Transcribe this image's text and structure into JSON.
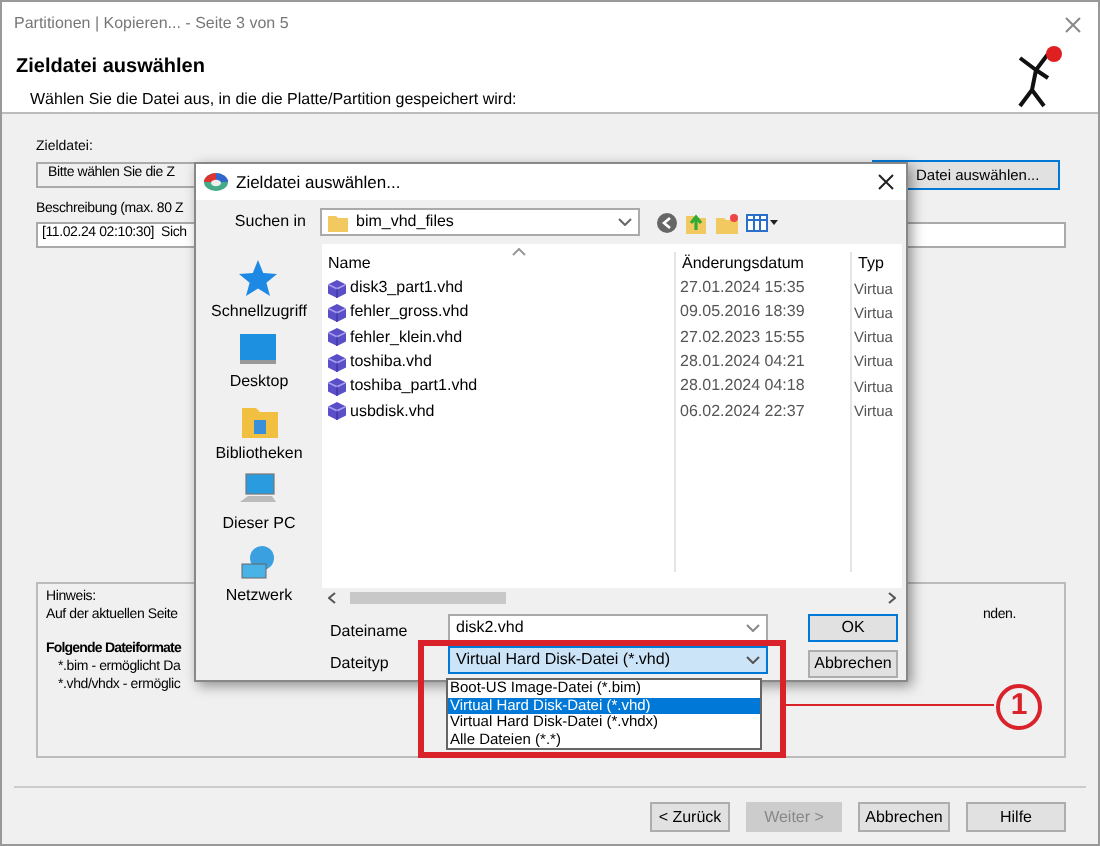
{
  "window": {
    "title": "Partitionen | Kopieren...  -  Seite 3 von 5"
  },
  "header": {
    "title": "Zieldatei auswählen",
    "subtitle": "Wählen Sie die Datei aus, in die die Platte/Partition gespeichert wird:"
  },
  "target": {
    "label": "Zieldatei:",
    "value": "Bitte wählen Sie die Z",
    "button": "Datei auswählen..."
  },
  "description": {
    "label": "Beschreibung (max. 80 Z",
    "value": "[11.02.24 02:10:30]  Sich"
  },
  "hint": {
    "title": "Hinweis:",
    "text_left": "Auf der aktuellen Seite",
    "text_right": "nden.",
    "formats_title": "Folgende Dateiformate",
    "formats": [
      "*.bim - ermöglicht Da",
      "*.vhd/vhdx - ermöglic"
    ]
  },
  "buttons": [
    {
      "label": "< Zurück",
      "disabled": false
    },
    {
      "label": "Weiter >",
      "disabled": true
    },
    {
      "label": "Abbrechen",
      "disabled": false
    },
    {
      "label": "Hilfe",
      "disabled": false
    }
  ],
  "dialog": {
    "title": "Zieldatei auswählen...",
    "look_in_label": "Suchen in",
    "look_in": "bim_vhd_files",
    "places": [
      {
        "label": "Schnellzugriff",
        "kind": "star"
      },
      {
        "label": "Desktop",
        "kind": "desktop"
      },
      {
        "label": "Bibliotheken",
        "kind": "library"
      },
      {
        "label": "Dieser PC",
        "kind": "pc"
      },
      {
        "label": "Netzwerk",
        "kind": "network"
      }
    ],
    "columns": [
      "Name",
      "Änderungsdatum",
      "Typ"
    ],
    "files": [
      {
        "name": "disk3_part1.vhd",
        "date": "27.01.2024 15:35",
        "type": "Virtua"
      },
      {
        "name": "fehler_gross.vhd",
        "date": "09.05.2016 18:39",
        "type": "Virtua"
      },
      {
        "name": "fehler_klein.vhd",
        "date": "27.02.2023 15:55",
        "type": "Virtua"
      },
      {
        "name": "toshiba.vhd",
        "date": "28.01.2024 04:21",
        "type": "Virtua"
      },
      {
        "name": "toshiba_part1.vhd",
        "date": "28.01.2024 04:18",
        "type": "Virtua"
      },
      {
        "name": "usbdisk.vhd",
        "date": "06.02.2024 22:37",
        "type": "Virtua"
      }
    ],
    "filename_label": "Dateiname",
    "filename": "disk2.vhd",
    "filetype_label": "Dateityp",
    "filetype": "Virtual Hard Disk-Datei (*.vhd)",
    "filetype_options": [
      {
        "label": "Boot-US Image-Datei (*.bim)",
        "selected": false
      },
      {
        "label": "Virtual Hard Disk-Datei (*.vhd)",
        "selected": true
      },
      {
        "label": "Virtual Hard Disk-Datei (*.vhdx)",
        "selected": false
      },
      {
        "label": "Alle Dateien (*.*)",
        "selected": false
      }
    ],
    "ok": "OK",
    "cancel": "Abbrechen"
  },
  "callout": {
    "number": "1"
  }
}
